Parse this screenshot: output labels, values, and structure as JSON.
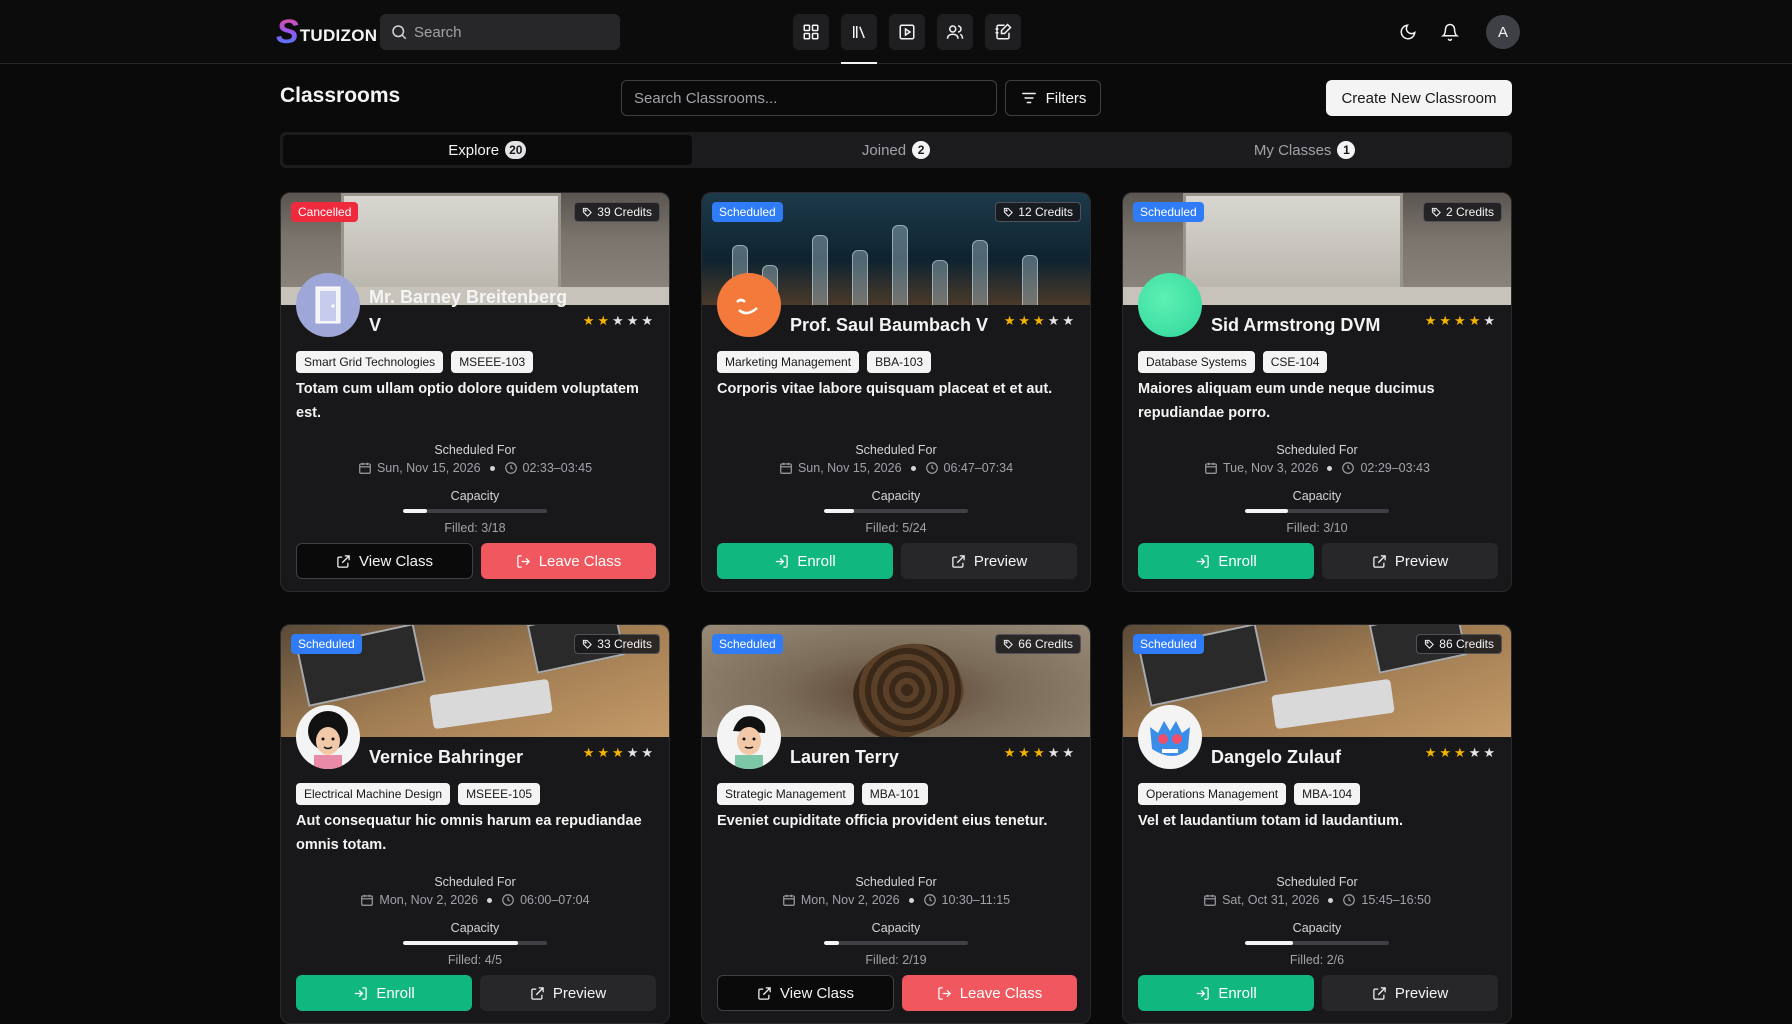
{
  "app": {
    "logo_letter": "S",
    "logo_text": "TUDIZON",
    "search_placeholder": "Search",
    "user_initial": "A"
  },
  "toolbar": {
    "title": "Classrooms",
    "search_placeholder": "Search Classrooms...",
    "filters_label": "Filters",
    "create_label": "Create New Classroom"
  },
  "tabs": [
    {
      "label": "Explore",
      "count": "20"
    },
    {
      "label": "Joined",
      "count": "2"
    },
    {
      "label": "My Classes",
      "count": "1"
    }
  ],
  "labels": {
    "scheduled_for": "Scheduled For",
    "capacity": "Capacity"
  },
  "cards": [
    {
      "status": "Cancelled",
      "credits": "39 Credits",
      "instructor": "Mr. Barney Breitenberg V",
      "rating": 2,
      "tags": [
        "Smart Grid Technologies",
        "MSEEE-103"
      ],
      "description": "Totam cum ullam optio dolore quidem voluptatem est.",
      "date": "Sun, Nov 15, 2026",
      "time": "02:33–03:45",
      "filled": "Filled: 3/18",
      "fill_ratio": 0.167,
      "primary": "View Class",
      "secondary": "Leave Class"
    },
    {
      "status": "Scheduled",
      "credits": "12 Credits",
      "instructor": "Prof. Saul Baumbach V",
      "rating": 3,
      "tags": [
        "Marketing Management",
        "BBA-103"
      ],
      "description": "Corporis vitae labore quisquam placeat et et aut.",
      "date": "Sun, Nov 15, 2026",
      "time": "06:47–07:34",
      "filled": "Filled: 5/24",
      "fill_ratio": 0.208,
      "primary": "Enroll",
      "secondary": "Preview"
    },
    {
      "status": "Scheduled",
      "credits": "2 Credits",
      "instructor": "Sid Armstrong DVM",
      "rating": 4,
      "tags": [
        "Database Systems",
        "CSE-104"
      ],
      "description": "Maiores aliquam eum unde neque ducimus repudiandae porro.",
      "date": "Tue, Nov 3, 2026",
      "time": "02:29–03:43",
      "filled": "Filled: 3/10",
      "fill_ratio": 0.3,
      "primary": "Enroll",
      "secondary": "Preview"
    },
    {
      "status": "Scheduled",
      "credits": "33 Credits",
      "instructor": "Vernice Bahringer",
      "rating": 3,
      "tags": [
        "Electrical Machine Design",
        "MSEEE-105"
      ],
      "description": "Aut consequatur hic omnis harum ea repudiandae omnis totam.",
      "date": "Mon, Nov 2, 2026",
      "time": "06:00–07:04",
      "filled": "Filled: 4/5",
      "fill_ratio": 0.8,
      "primary": "Enroll",
      "secondary": "Preview"
    },
    {
      "status": "Scheduled",
      "credits": "66 Credits",
      "instructor": "Lauren Terry",
      "rating": 3,
      "tags": [
        "Strategic Management",
        "MBA-101"
      ],
      "description": "Eveniet cupiditate officia provident eius tenetur.",
      "date": "Mon, Nov 2, 2026",
      "time": "10:30–11:15",
      "filled": "Filled: 2/19",
      "fill_ratio": 0.105,
      "primary": "View Class",
      "secondary": "Leave Class"
    },
    {
      "status": "Scheduled",
      "credits": "86 Credits",
      "instructor": "Dangelo Zulauf",
      "rating": 3,
      "tags": [
        "Operations Management",
        "MBA-104"
      ],
      "description": "Vel et laudantium totam id laudantium.",
      "date": "Sat, Oct 31, 2026",
      "time": "15:45–16:50",
      "filled": "Filled: 2/6",
      "fill_ratio": 0.333,
      "primary": "Enroll",
      "secondary": "Preview"
    }
  ],
  "colors": {
    "cancelled": "#ef2a3c",
    "scheduled": "#2f7cf6",
    "enroll": "#10b77f",
    "leave": "#f0575f"
  }
}
